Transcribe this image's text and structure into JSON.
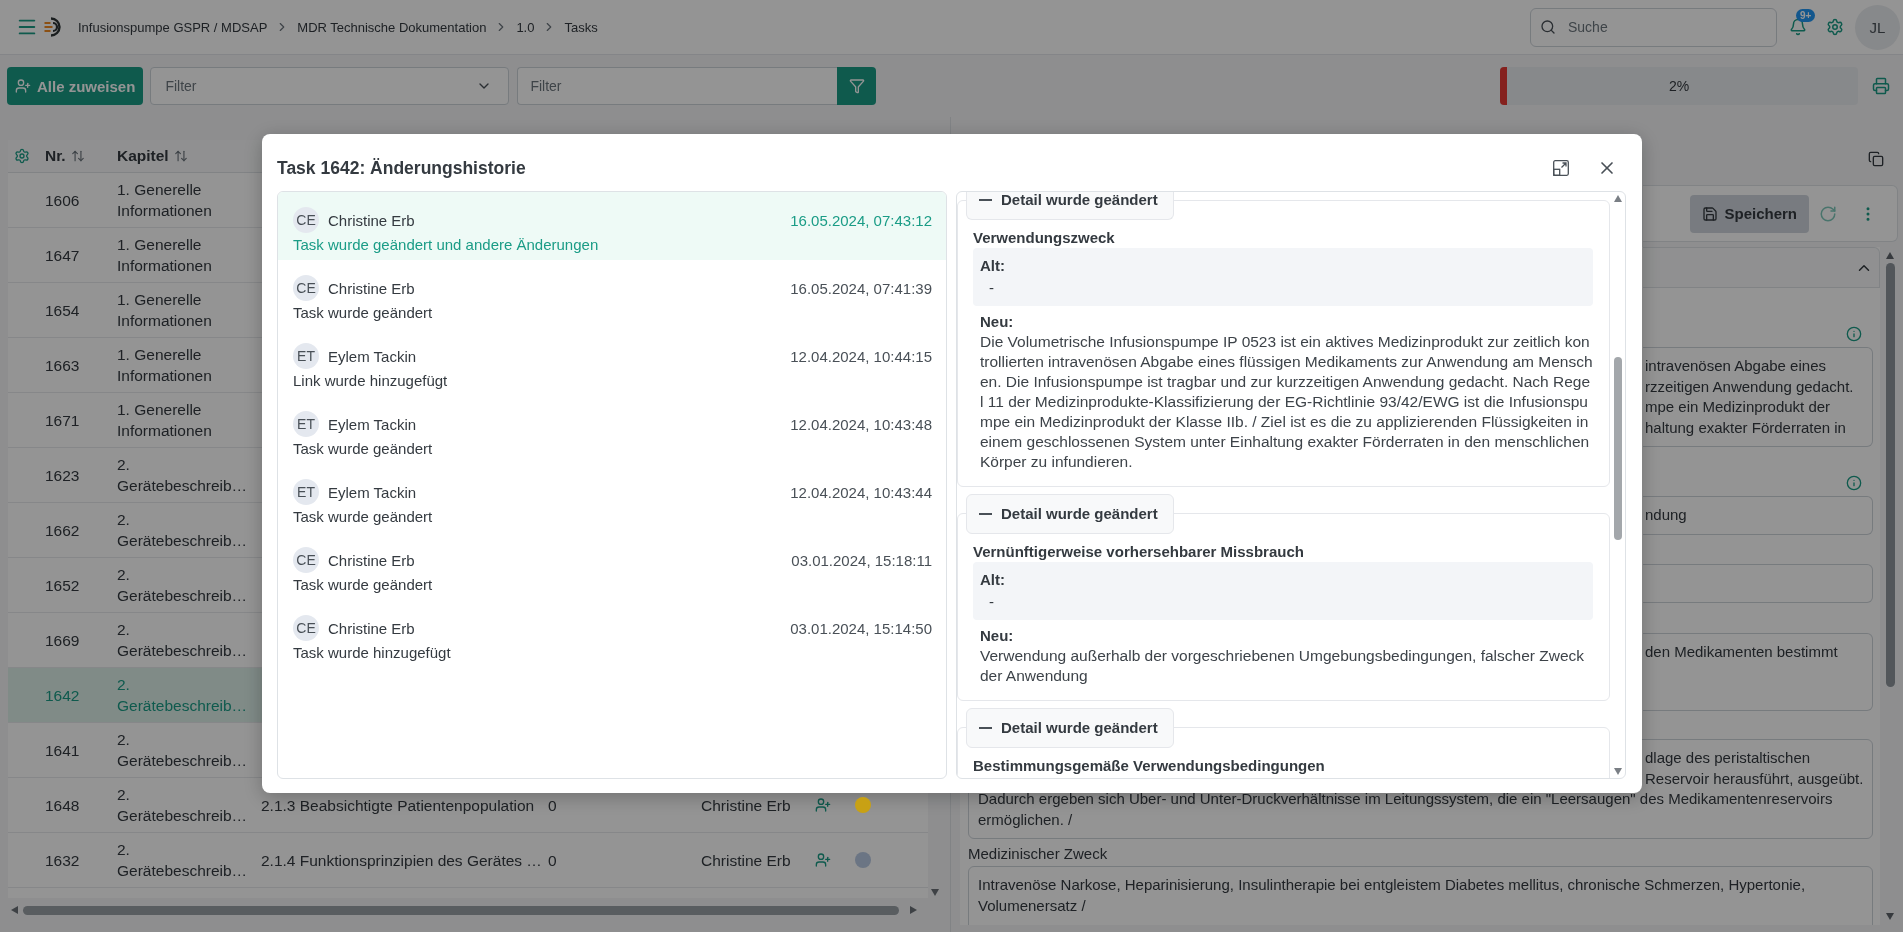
{
  "topbar": {
    "breadcrumbs": [
      "Infusionspumpe GSPR / MDSAP",
      "MDR Technische Dokumentation",
      "1.0",
      "Tasks"
    ],
    "search": {
      "placeholder": "Suche"
    },
    "notification_badge": "9+",
    "avatar": "JL"
  },
  "toolbar": {
    "assign_button": "Alle zuweisen",
    "filter_select": {
      "placeholder": "Filter"
    },
    "filter_input": {
      "placeholder": "Filter"
    },
    "progress": {
      "level": 0.02,
      "reading": "2%"
    }
  },
  "table": {
    "columns": [
      {
        "label": "Nr."
      },
      {
        "label": "Kapitel"
      }
    ],
    "rows": [
      {
        "nr": "1606",
        "kapitel": "1. Generelle Informationen",
        "selected": false
      },
      {
        "nr": "1647",
        "kapitel": "1. Generelle Informationen",
        "selected": false
      },
      {
        "nr": "1654",
        "kapitel": "1. Generelle Informationen",
        "selected": false
      },
      {
        "nr": "1663",
        "kapitel": "1. Generelle Informationen",
        "selected": false
      },
      {
        "nr": "1671",
        "kapitel": "1. Generelle Informationen",
        "selected": false
      },
      {
        "nr": "1623",
        "kapitel": "2. Gerätebeschreib…",
        "selected": false
      },
      {
        "nr": "1662",
        "kapitel": "2. Gerätebeschreib…",
        "selected": false
      },
      {
        "nr": "1652",
        "kapitel": "2. Gerätebeschreib…",
        "selected": false
      },
      {
        "nr": "1669",
        "kapitel": "2. Gerätebeschreib…",
        "selected": false
      },
      {
        "nr": "1642",
        "kapitel": "2. Gerätebeschreib…",
        "selected": true
      },
      {
        "nr": "1641",
        "kapitel": "2. Gerätebeschreib…",
        "selected": false
      },
      {
        "nr": "1648",
        "kapitel": "2. Gerätebeschreib…",
        "selected": false,
        "column_3": "2.1.3 Beabsichtigte Patientenpopulation",
        "column_4": "0",
        "column_5": "Christine Erb",
        "color": "#c8a114"
      },
      {
        "nr": "1632",
        "kapitel": "2. Gerätebeschreib…",
        "selected": false,
        "column_3": "2.1.4 Funktionsprinzipien des Gerätes …",
        "column_4": "0",
        "column_5": "Christine Erb",
        "color": "#6b7584"
      }
    ]
  },
  "editor": {
    "save_button": "Speichern",
    "section": {
      "expanded": true
    },
    "fields": [
      {
        "kind": "textarea",
        "info": true,
        "lines": [
          "intravenösen Abgabe eines",
          "rzzeitigen Anwendung gedacht.",
          "mpe ein Medizinprodukt der",
          "haltung exakter Förderraten in"
        ]
      },
      {
        "kind": "input",
        "info": true,
        "lines": [
          "ndung"
        ]
      },
      {
        "kind": "input"
      },
      {
        "kind": "textarea",
        "lines": [
          "den Medikamenten bestimmt"
        ]
      },
      {
        "kind": "textarea",
        "lines": [
          "dlage des peristaltischen",
          "Reservoir herausführt, ausgeübt.",
          "Dadurch ergeben sich Über- und Unter-Druckverhältnisse im Leitungssystem, die ein \"Leersaugen\" des Medikamentenreservoirs",
          "ermöglichen. /"
        ]
      },
      {
        "kind": "textarea",
        "label": "Medizinischer Zweck",
        "lines": [
          "Intravenöse Narkose, Heparinisierung, Insulintherapie bei entgleistem Diabetes mellitus, chronische Schmerzen, Hypertonie,",
          "Volumenersatz /"
        ]
      }
    ]
  },
  "dialog": {
    "title": "Task 1642: Änderungshistorie",
    "history": [
      {
        "initials": "CE",
        "name": "Christine Erb",
        "date": "16.05.2024, 07:43:12",
        "description": "Task wurde geändert und andere Änderungen",
        "selected": true
      },
      {
        "initials": "CE",
        "name": "Christine Erb",
        "date": "16.05.2024, 07:41:39",
        "description": "Task wurde geändert",
        "selected": false
      },
      {
        "initials": "ET",
        "name": "Eylem Tackin",
        "date": "12.04.2024, 10:44:15",
        "description": "Link wurde hinzugefügt",
        "selected": false
      },
      {
        "initials": "ET",
        "name": "Eylem Tackin",
        "date": "12.04.2024, 10:43:48",
        "description": "Task wurde geändert",
        "selected": false
      },
      {
        "initials": "ET",
        "name": "Eylem Tackin",
        "date": "12.04.2024, 10:43:44",
        "description": "Task wurde geändert",
        "selected": false
      },
      {
        "initials": "CE",
        "name": "Christine Erb",
        "date": "03.01.2024, 15:18:11",
        "description": "Task wurde geändert",
        "selected": false
      },
      {
        "initials": "CE",
        "name": "Christine Erb",
        "date": "03.01.2024, 15:14:50",
        "description": "Task wurde hinzugefügt",
        "selected": false
      }
    ],
    "details": [
      {
        "legend": "Detail wurde geändert",
        "expanded": true,
        "field": "Verwendungszweck",
        "old_label": "Alt:",
        "old_value": "-",
        "new_label": "Neu:",
        "new_value": "Die Volumetrische Infusionspumpe IP 0523 ist ein aktives Medizinprodukt zur zeitlich kontrollierten intravenösen Abgabe eines flüssigen Medikaments zur Anwendung am Menschen. Die Infusionspumpe ist tragbar und zur kurzzeitigen Anwendung gedacht. Nach Regel 11 der Medizinprodukte-Klassifizierung der EG-Richtlinie 93/42/EWG ist die Infusionspumpe ein Medizinprodukt der Klasse IIb. / Ziel ist es die zu applizierenden Flüssigkeiten in einem geschlossenen System unter Einhaltung exakter Förderraten in den menschlichen Körper zu infundieren."
      },
      {
        "legend": "Detail wurde geändert",
        "expanded": true,
        "field": "Vernünftigerweise vorhersehbarer Missbrauch",
        "old_label": "Alt:",
        "old_value": "-",
        "new_label": "Neu:",
        "new_value": "Verwendung außerhalb der vorgeschriebenen Umgebungsbedingungen, falscher Zweck der Anwendung"
      },
      {
        "legend": "Detail wurde geändert",
        "expanded": true,
        "field": "Bestimmungsgemäße Verwendungsbedingungen"
      }
    ]
  }
}
